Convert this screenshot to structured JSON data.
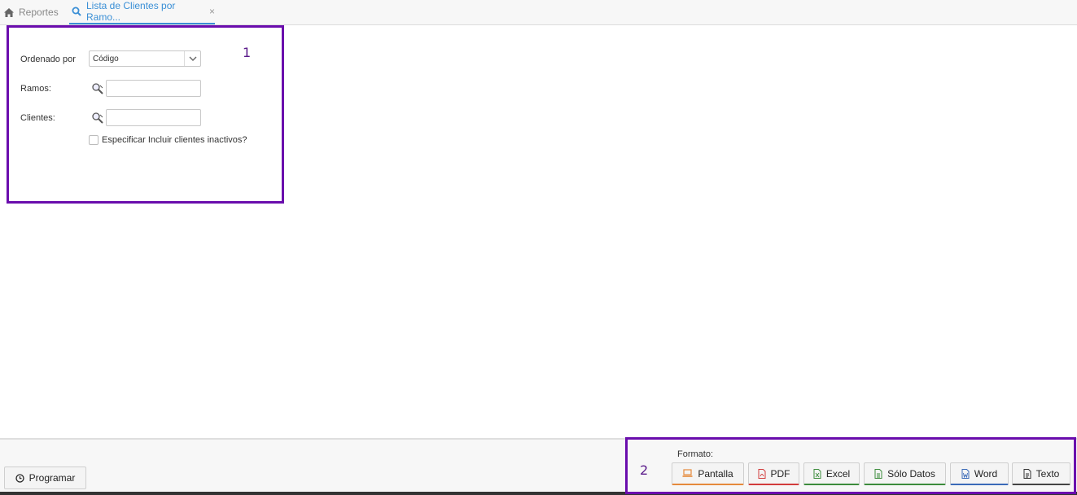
{
  "tabs": {
    "reportes": {
      "label": "Reportes",
      "icon": "home-icon"
    },
    "active": {
      "label": "Lista de Clientes por Ramo...",
      "icon": "search-icon",
      "close": "×"
    }
  },
  "annotations": {
    "box1": "1",
    "box2": "2",
    "color": "#6a0dad"
  },
  "form": {
    "ordenado_label": "Ordenado por",
    "ordenado_value": "Código",
    "ramos_label": "Ramos:",
    "ramos_value": "",
    "clientes_label": "Clientes:",
    "clientes_value": "",
    "inactivos_label": "Especificar Incluir clientes inactivos?",
    "inactivos_checked": false
  },
  "footer": {
    "programar_label": "Programar",
    "formato_label": "Formato:",
    "buttons": {
      "pantalla": "Pantalla",
      "pdf": "PDF",
      "excel": "Excel",
      "solo_datos": "Sólo Datos",
      "word": "Word",
      "texto": "Texto"
    }
  },
  "colors": {
    "accent": "#3a8fd6",
    "pdf": "#d23c3c",
    "excel": "#3c8c3c",
    "word": "#3a6ab8",
    "pantalla": "#e58a3c"
  }
}
